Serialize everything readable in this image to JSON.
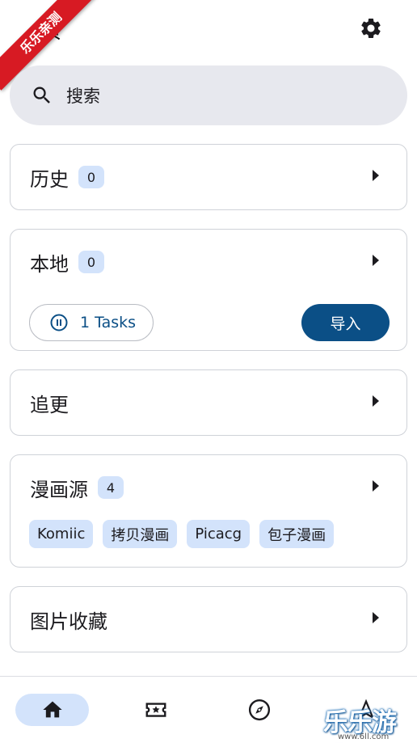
{
  "header": {
    "title_fragment": "页",
    "settings_icon": "gear-icon"
  },
  "ribbon": {
    "text": "乐乐亲测",
    "color": "#d71a23"
  },
  "search": {
    "placeholder": "搜索",
    "icon": "search-icon"
  },
  "cards": {
    "history": {
      "title": "历史",
      "count": "0"
    },
    "local": {
      "title": "本地",
      "count": "0",
      "tasks_label": "1 Tasks",
      "import_label": "导入"
    },
    "following": {
      "title": "追更"
    },
    "sources": {
      "title": "漫画源",
      "count": "4",
      "chips": [
        "Komiic",
        "拷贝漫画",
        "Picacg",
        "包子漫画"
      ]
    },
    "image_favorites": {
      "title": "图片收藏"
    }
  },
  "bottom_nav": {
    "items": [
      {
        "icon": "home-icon",
        "active": true
      },
      {
        "icon": "ticket-star-icon",
        "active": false
      },
      {
        "icon": "compass-icon",
        "active": false
      },
      {
        "icon": "navigation-arrow-icon",
        "active": false
      }
    ]
  },
  "watermark": {
    "main": "乐乐游戏",
    "sub": "www.6ll.com"
  },
  "colors": {
    "accent": "#0b4f86",
    "chip_bg": "#d3e3fb",
    "search_bg": "#e7e8ee",
    "card_border": "#cfd2d8"
  }
}
